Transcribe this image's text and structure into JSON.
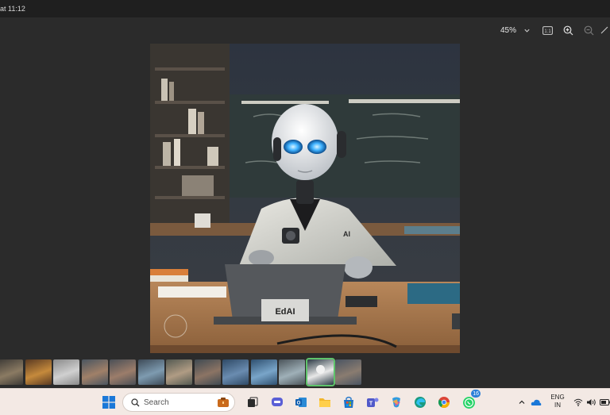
{
  "window": {
    "title": "at 11:12"
  },
  "toolbar": {
    "zoom_level": "45%",
    "zoom_dropdown_icon": "chevron-down-icon",
    "actual_size_icon": "actual-size-icon",
    "zoom_in_icon": "zoom-in-icon",
    "zoom_out_icon": "zoom-out-icon"
  },
  "photo": {
    "laptop_label": "EdAI",
    "coat_label": "AI"
  },
  "filmstrip": {
    "thumbnails": [
      {
        "color": "#3d3a36",
        "accent": "#8b7b63"
      },
      {
        "color": "#5a3a22",
        "accent": "#c58a3c"
      },
      {
        "color": "#8a8a8a",
        "accent": "#d0d0d0"
      },
      {
        "color": "#4a5560",
        "accent": "#a08068"
      },
      {
        "color": "#4a4f56",
        "accent": "#9c7d6a"
      },
      {
        "color": "#3e4b58",
        "accent": "#7e9bb0"
      },
      {
        "color": "#545a52",
        "accent": "#b09c84"
      },
      {
        "color": "#3f4a52",
        "accent": "#8c7464"
      },
      {
        "color": "#2f4a66",
        "accent": "#6a8cb0"
      },
      {
        "color": "#2f5070",
        "accent": "#79a5c9"
      },
      {
        "color": "#4b545a",
        "accent": "#9fb0b8"
      },
      {
        "color": "#2c3b45",
        "accent": "#e8e8e8"
      },
      {
        "color": "#4a5462",
        "accent": "#8a7c70"
      }
    ],
    "selected_index": 11
  },
  "taskbar": {
    "search_placeholder": "Search",
    "whatsapp_badge": "16",
    "language_line1": "ENG",
    "language_line2": "IN"
  },
  "colors": {
    "accent_green": "#5fc46b",
    "taskbar_bg": "#f3e9e4",
    "viewer_bg": "#2b2b2b"
  }
}
